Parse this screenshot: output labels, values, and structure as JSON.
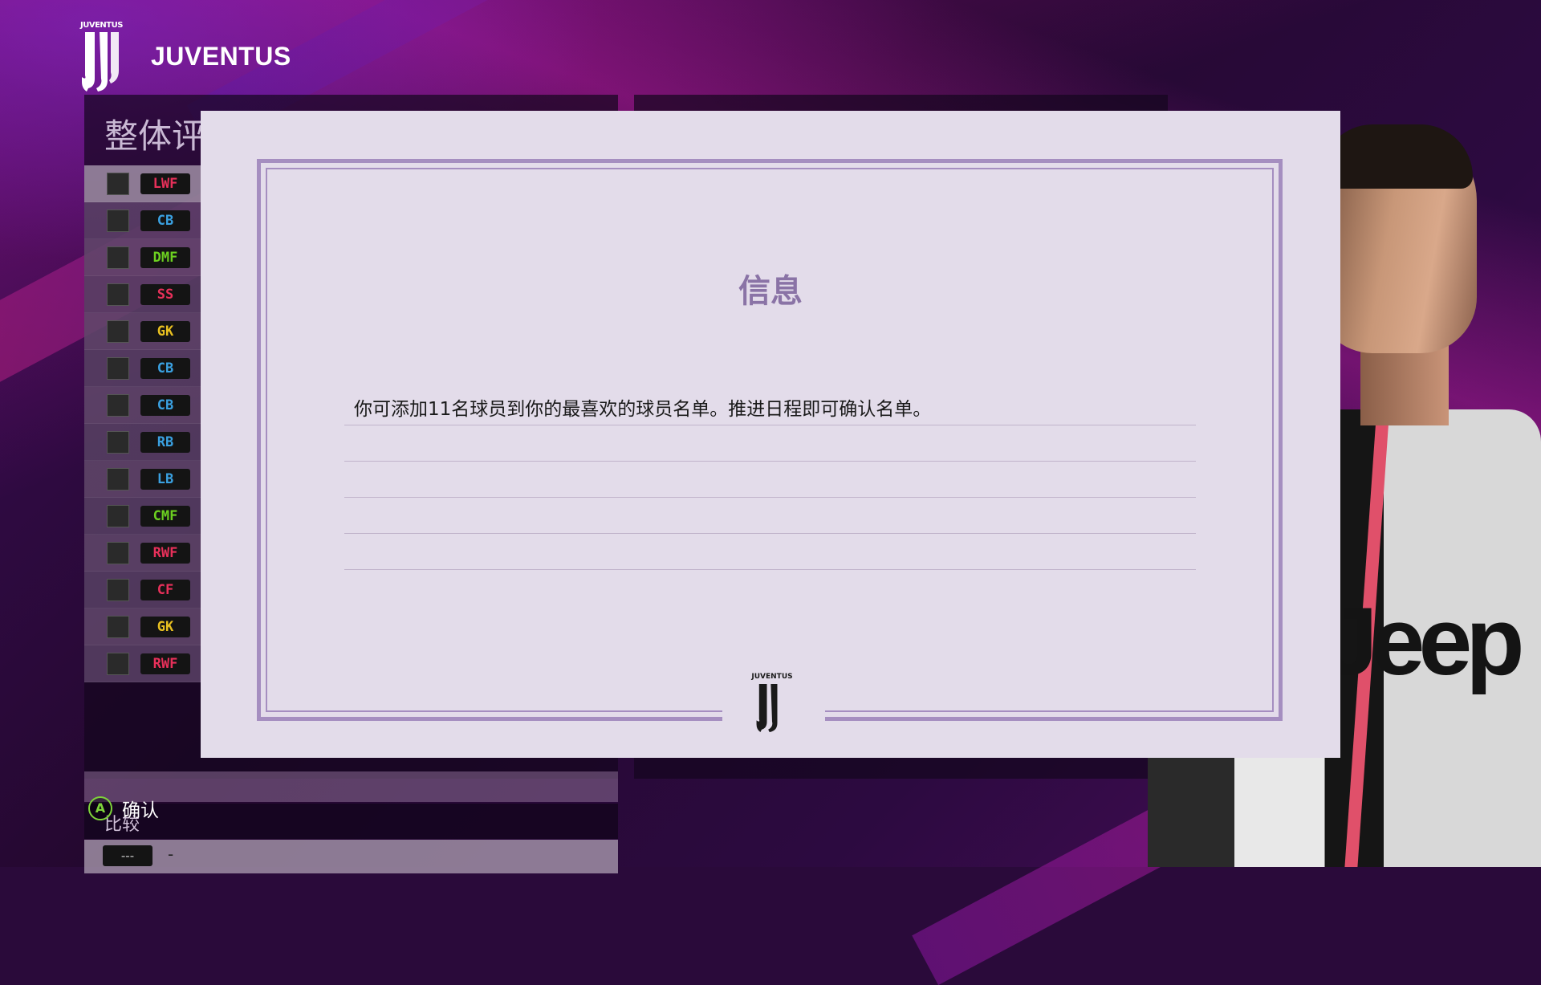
{
  "header": {
    "club_small": "JUVENTUS",
    "team_name": "JUVENTUS"
  },
  "left_panel": {
    "title": "整体评",
    "roster": [
      {
        "pos": "LWF",
        "color": "red"
      },
      {
        "pos": "CB",
        "color": "blue"
      },
      {
        "pos": "DMF",
        "color": "green"
      },
      {
        "pos": "SS",
        "color": "red"
      },
      {
        "pos": "GK",
        "color": "yellow"
      },
      {
        "pos": "CB",
        "color": "blue"
      },
      {
        "pos": "CB",
        "color": "blue"
      },
      {
        "pos": "RB",
        "color": "blue"
      },
      {
        "pos": "LB",
        "color": "blue"
      },
      {
        "pos": "CMF",
        "color": "green"
      },
      {
        "pos": "RWF",
        "color": "red"
      },
      {
        "pos": "CF",
        "color": "red"
      },
      {
        "pos": "GK",
        "color": "yellow"
      },
      {
        "pos": "RWF",
        "color": "red"
      }
    ],
    "compare_label": "比较",
    "compare_value": "---",
    "compare_dash": "-"
  },
  "player_shirt_text": "Jeep",
  "dialog": {
    "title": "信息",
    "message": "你可添加11名球员到你的最喜欢的球员名单。推进日程即可确认名单。",
    "logo_small": "JUVENTUS"
  },
  "prompt": {
    "button": "A",
    "label": "确认"
  },
  "colors": {
    "red": "#e8305a",
    "blue": "#3aa0e0",
    "green": "#6cd020",
    "yellow": "#e8c020",
    "accent": "#a58ec0"
  }
}
